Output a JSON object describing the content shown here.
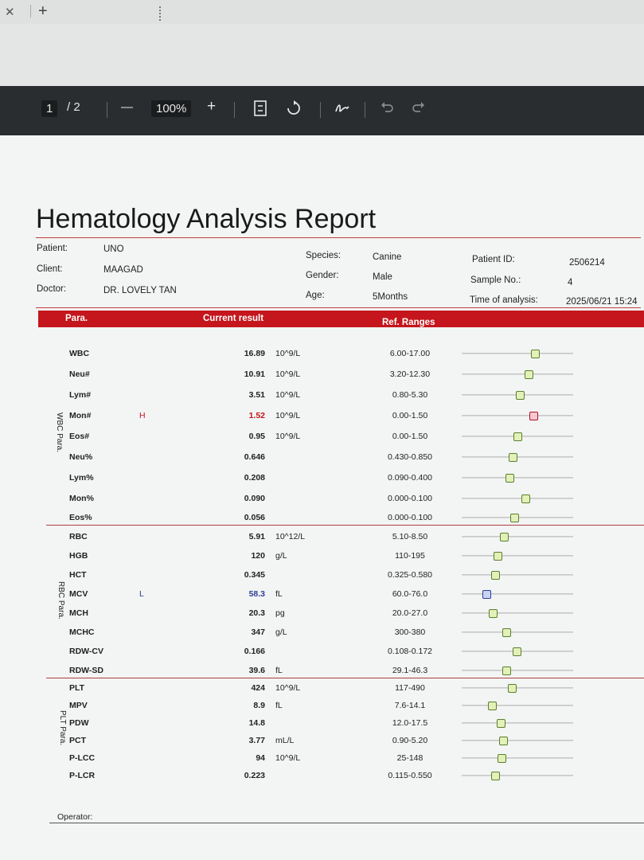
{
  "toolbar": {
    "page_current": "1",
    "page_total": "/ 2",
    "zoom_out": "—",
    "zoom": "100%",
    "zoom_in": "+"
  },
  "report": {
    "title": "Hematology Analysis Report",
    "info": {
      "patient_label": "Patient:",
      "patient": "UNO",
      "client_label": "Client:",
      "client": "MAAGAD",
      "doctor_label": "Doctor:",
      "doctor": "DR. LOVELY TAN",
      "species_label": "Species:",
      "species": "Canine",
      "gender_label": "Gender:",
      "gender": "Male",
      "age_label": "Age:",
      "age": "5Months",
      "patient_id_label": "Patient ID:",
      "patient_id": "2506214",
      "sample_label": "Sample No.:",
      "sample": "4",
      "time_label": "Time of analysis:",
      "time": "2025/06/21 15:24"
    },
    "headers": {
      "para": "Para.",
      "current": "Current result",
      "ref": "Ref. Ranges"
    },
    "groups": {
      "wbc": "WBC Para.",
      "rbc": "RBC Para.",
      "plt": "PLT Para."
    },
    "rows": [
      {
        "name": "WBC",
        "flag": "",
        "value": "16.89",
        "unit": "10^9/L",
        "ref": "6.00-17.00",
        "pos": 0.66,
        "status": "normal"
      },
      {
        "name": "Neu#",
        "flag": "",
        "value": "10.91",
        "unit": "10^9/L",
        "ref": "3.20-12.30",
        "pos": 0.6,
        "status": "normal"
      },
      {
        "name": "Lym#",
        "flag": "",
        "value": "3.51",
        "unit": "10^9/L",
        "ref": "0.80-5.30",
        "pos": 0.52,
        "status": "normal"
      },
      {
        "name": "Mon#",
        "flag": "H",
        "value": "1.52",
        "unit": "10^9/L",
        "ref": "0.00-1.50",
        "pos": 0.64,
        "status": "high"
      },
      {
        "name": "Eos#",
        "flag": "",
        "value": "0.95",
        "unit": "10^9/L",
        "ref": "0.00-1.50",
        "pos": 0.5,
        "status": "normal"
      },
      {
        "name": "Neu%",
        "flag": "",
        "value": "0.646",
        "unit": "",
        "ref": "0.430-0.850",
        "pos": 0.46,
        "status": "normal"
      },
      {
        "name": "Lym%",
        "flag": "",
        "value": "0.208",
        "unit": "",
        "ref": "0.090-0.400",
        "pos": 0.43,
        "status": "normal"
      },
      {
        "name": "Mon%",
        "flag": "",
        "value": "0.090",
        "unit": "",
        "ref": "0.000-0.100",
        "pos": 0.57,
        "status": "normal"
      },
      {
        "name": "Eos%",
        "flag": "",
        "value": "0.056",
        "unit": "",
        "ref": "0.000-0.100",
        "pos": 0.47,
        "status": "normal"
      },
      {
        "name": "RBC",
        "flag": "",
        "value": "5.91",
        "unit": "10^12/L",
        "ref": "5.10-8.50",
        "pos": 0.38,
        "status": "normal"
      },
      {
        "name": "HGB",
        "flag": "",
        "value": "120",
        "unit": "g/L",
        "ref": "110-195",
        "pos": 0.32,
        "status": "normal"
      },
      {
        "name": "HCT",
        "flag": "",
        "value": "0.345",
        "unit": "",
        "ref": "0.325-0.580",
        "pos": 0.3,
        "status": "normal"
      },
      {
        "name": "MCV",
        "flag": "L",
        "value": "58.3",
        "unit": "fL",
        "ref": "60.0-76.0",
        "pos": 0.22,
        "status": "low"
      },
      {
        "name": "MCH",
        "flag": "",
        "value": "20.3",
        "unit": "pg",
        "ref": "20.0-27.0",
        "pos": 0.28,
        "status": "normal"
      },
      {
        "name": "MCHC",
        "flag": "",
        "value": "347",
        "unit": "g/L",
        "ref": "300-380",
        "pos": 0.4,
        "status": "normal"
      },
      {
        "name": "RDW-CV",
        "flag": "",
        "value": "0.166",
        "unit": "",
        "ref": "0.108-0.172",
        "pos": 0.49,
        "status": "normal"
      },
      {
        "name": "RDW-SD",
        "flag": "",
        "value": "39.6",
        "unit": "fL",
        "ref": "29.1-46.3",
        "pos": 0.4,
        "status": "normal"
      },
      {
        "name": "PLT",
        "flag": "",
        "value": "424",
        "unit": "10^9/L",
        "ref": "117-490",
        "pos": 0.45,
        "status": "normal"
      },
      {
        "name": "MPV",
        "flag": "",
        "value": "8.9",
        "unit": "fL",
        "ref": "7.6-14.1",
        "pos": 0.27,
        "status": "normal"
      },
      {
        "name": "PDW",
        "flag": "",
        "value": "14.8",
        "unit": "",
        "ref": "12.0-17.5",
        "pos": 0.35,
        "status": "normal"
      },
      {
        "name": "PCT",
        "flag": "",
        "value": "3.77",
        "unit": "mL/L",
        "ref": "0.90-5.20",
        "pos": 0.37,
        "status": "normal"
      },
      {
        "name": "P-LCC",
        "flag": "",
        "value": "94",
        "unit": "10^9/L",
        "ref": "25-148",
        "pos": 0.36,
        "status": "normal"
      },
      {
        "name": "P-LCR",
        "flag": "",
        "value": "0.223",
        "unit": "",
        "ref": "0.115-0.550",
        "pos": 0.3,
        "status": "normal"
      }
    ],
    "operator_label": "Operator:"
  }
}
